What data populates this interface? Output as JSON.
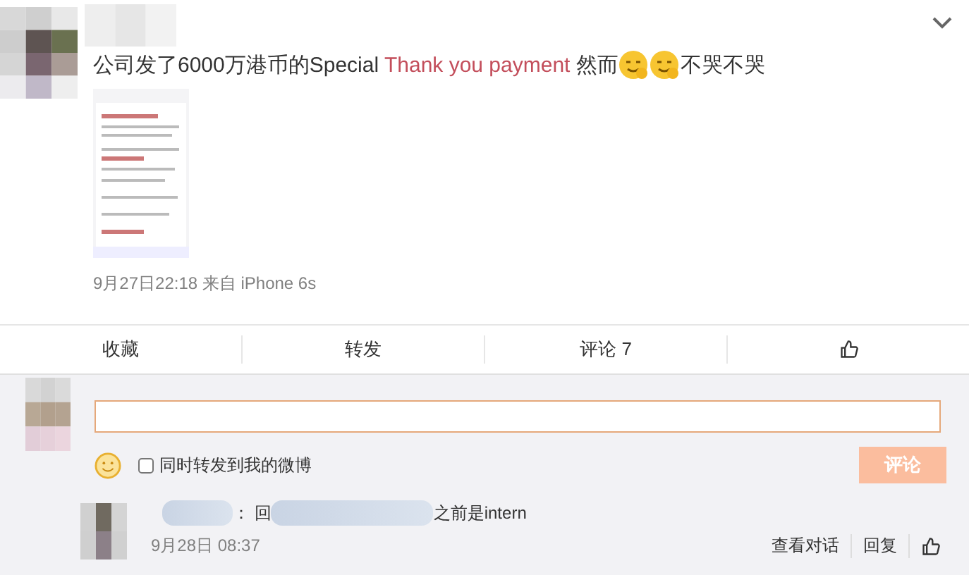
{
  "post": {
    "text_before": "公司发了6000万港币的Special ",
    "highlight": "Thank you payment",
    "text_after": " 然而",
    "emojis": [
      {
        "kind": "smile"
      },
      {
        "kind": "smile"
      }
    ],
    "text_end": "不哭不哭",
    "time": "9月27日22:18 来自 iPhone 6s"
  },
  "actions": [
    {
      "label": "收藏",
      "kind": "text"
    },
    {
      "label": "转发",
      "kind": "text"
    },
    {
      "label": "评论 7",
      "kind": "text"
    },
    {
      "kind": "like"
    }
  ],
  "composer": {
    "repost_label": "同时转发到我的微博",
    "repost_checked": false,
    "submit_label": "评论",
    "submit_disabled": true
  },
  "comments": [
    {
      "reply_prefix": "：  回",
      "text": "之前是intern",
      "time": "9月28日 08:37",
      "actions": [
        "查看对话",
        "回复"
      ]
    }
  ]
}
